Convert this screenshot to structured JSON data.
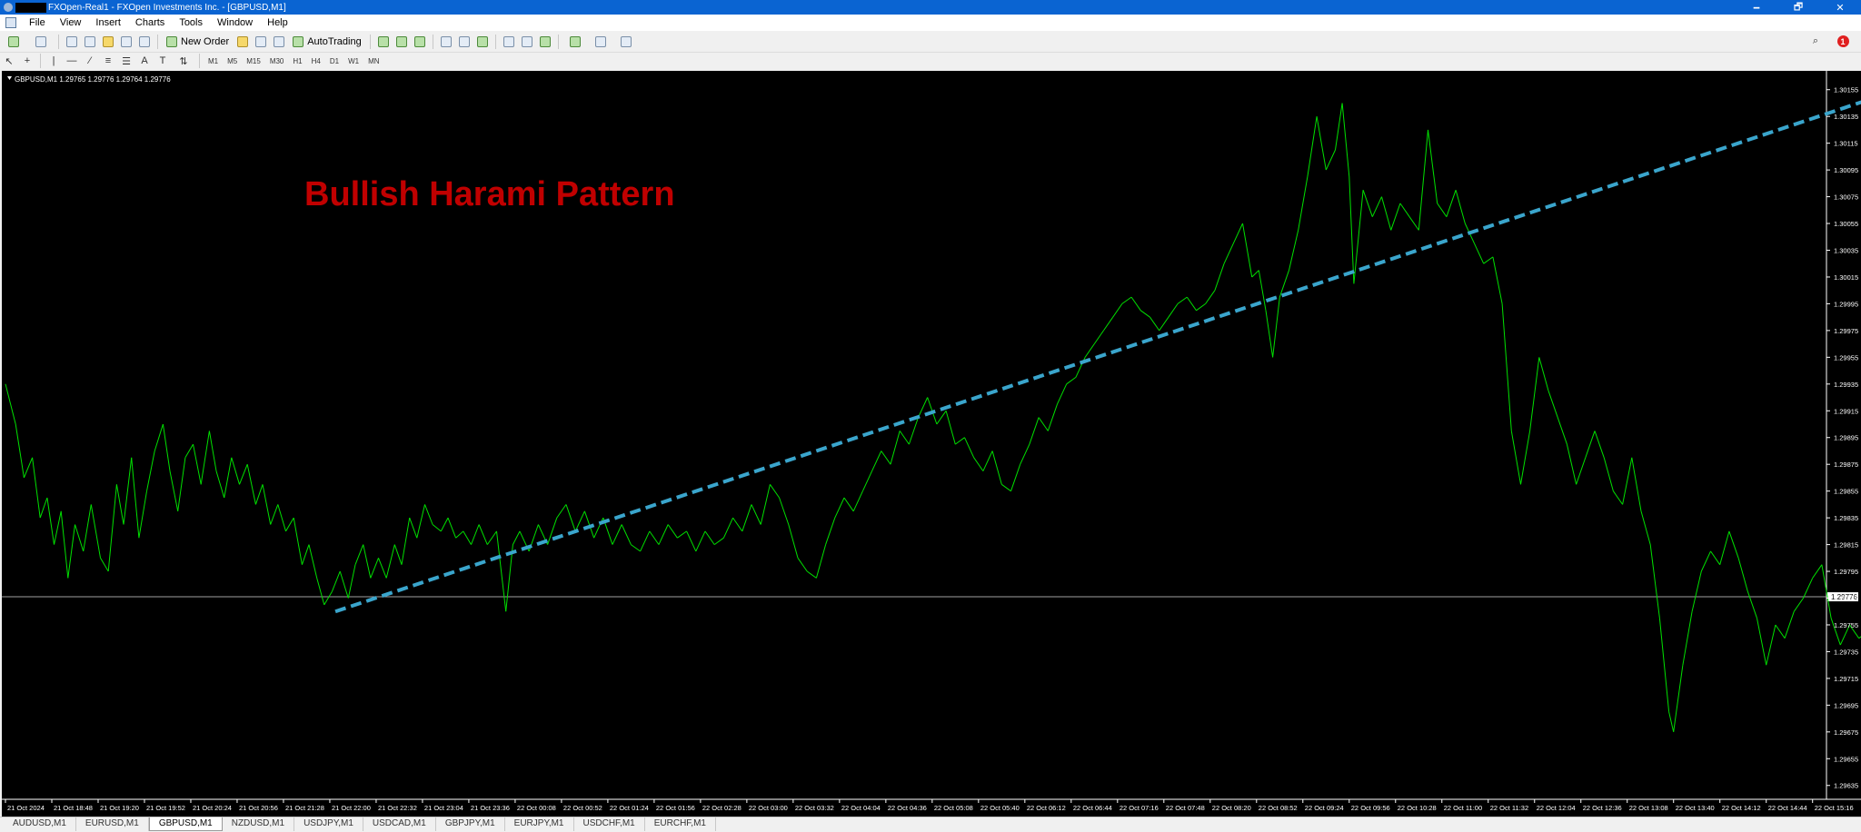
{
  "window": {
    "title": "FXOpen-Real1 - FXOpen Investments Inc. - [GBPUSD,M1]",
    "controls": [
      "🗕",
      "🗗",
      "✕"
    ]
  },
  "menu": [
    "File",
    "View",
    "Insert",
    "Charts",
    "Tools",
    "Window",
    "Help"
  ],
  "toolbar": {
    "new_order": "New Order",
    "autotrading": "AutoTrading",
    "timeframes": [
      "M1",
      "M5",
      "M15",
      "M30",
      "H1",
      "H4",
      "D1",
      "W1",
      "MN"
    ],
    "notification_count": "1"
  },
  "chart": {
    "info": "GBPUSD,M1  1.29765 1.29776 1.29764 1.29776",
    "annotation": "Bullish Harami Pattern",
    "annotation_color": "#c00000",
    "line_color": "#00e000",
    "trend_color": "#3aa5cc",
    "bid_label": "1.29776",
    "bid_price": 1.29776
  },
  "chart_data": {
    "type": "line",
    "symbol": "GBPUSD",
    "timeframe": "M1",
    "x_ticks": [
      "21 Oct 2024",
      "21 Oct 18:48",
      "21 Oct 19:20",
      "21 Oct 19:52",
      "21 Oct 20:24",
      "21 Oct 20:56",
      "21 Oct 21:28",
      "21 Oct 22:00",
      "21 Oct 22:32",
      "21 Oct 23:04",
      "21 Oct 23:36",
      "22 Oct 00:08",
      "22 Oct 00:52",
      "22 Oct 01:24",
      "22 Oct 01:56",
      "22 Oct 02:28",
      "22 Oct 03:00",
      "22 Oct 03:32",
      "22 Oct 04:04",
      "22 Oct 04:36",
      "22 Oct 05:08",
      "22 Oct 05:40",
      "22 Oct 06:12",
      "22 Oct 06:44",
      "22 Oct 07:16",
      "22 Oct 07:48",
      "22 Oct 08:20",
      "22 Oct 08:52",
      "22 Oct 09:24",
      "22 Oct 09:56",
      "22 Oct 10:28",
      "22 Oct 11:00",
      "22 Oct 11:32",
      "22 Oct 12:04",
      "22 Oct 12:36",
      "22 Oct 13:08",
      "22 Oct 13:40",
      "22 Oct 14:12",
      "22 Oct 14:44",
      "22 Oct 15:16"
    ],
    "y_ticks": [
      "1.30155",
      "1.30135",
      "1.30115",
      "1.30095",
      "1.30075",
      "1.30055",
      "1.30035",
      "1.30015",
      "1.29995",
      "1.29975",
      "1.29955",
      "1.29935",
      "1.29915",
      "1.29895",
      "1.29875",
      "1.29855",
      "1.29835",
      "1.29815",
      "1.29795",
      "1.29775",
      "1.29755",
      "1.29735",
      "1.29715",
      "1.29695",
      "1.29675",
      "1.29655",
      "1.29635"
    ],
    "ylim": [
      1.29626,
      1.30165
    ],
    "xlim": [
      0,
      39
    ],
    "series": [
      {
        "points": [
          [
            0.0,
            1.29935
          ],
          [
            0.22,
            1.29905
          ],
          [
            0.4,
            1.29865
          ],
          [
            0.58,
            1.2988
          ],
          [
            0.75,
            1.29835
          ],
          [
            0.9,
            1.2985
          ],
          [
            1.05,
            1.29815
          ],
          [
            1.2,
            1.2984
          ],
          [
            1.35,
            1.2979
          ],
          [
            1.5,
            1.2983
          ],
          [
            1.68,
            1.2981
          ],
          [
            1.85,
            1.29845
          ],
          [
            2.05,
            1.29805
          ],
          [
            2.22,
            1.29795
          ],
          [
            2.4,
            1.2986
          ],
          [
            2.55,
            1.2983
          ],
          [
            2.72,
            1.2988
          ],
          [
            2.88,
            1.2982
          ],
          [
            3.05,
            1.29855
          ],
          [
            3.22,
            1.29885
          ],
          [
            3.4,
            1.29905
          ],
          [
            3.55,
            1.2987
          ],
          [
            3.72,
            1.2984
          ],
          [
            3.88,
            1.2988
          ],
          [
            4.05,
            1.2989
          ],
          [
            4.22,
            1.2986
          ],
          [
            4.4,
            1.299
          ],
          [
            4.55,
            1.2987
          ],
          [
            4.72,
            1.2985
          ],
          [
            4.88,
            1.2988
          ],
          [
            5.05,
            1.2986
          ],
          [
            5.22,
            1.29875
          ],
          [
            5.4,
            1.29845
          ],
          [
            5.55,
            1.2986
          ],
          [
            5.72,
            1.2983
          ],
          [
            5.88,
            1.29845
          ],
          [
            6.05,
            1.29825
          ],
          [
            6.22,
            1.29835
          ],
          [
            6.4,
            1.298
          ],
          [
            6.55,
            1.29815
          ],
          [
            6.72,
            1.2979
          ],
          [
            6.88,
            1.2977
          ],
          [
            7.05,
            1.2978
          ],
          [
            7.22,
            1.29795
          ],
          [
            7.4,
            1.29775
          ],
          [
            7.55,
            1.298
          ],
          [
            7.72,
            1.29815
          ],
          [
            7.88,
            1.2979
          ],
          [
            8.05,
            1.29805
          ],
          [
            8.22,
            1.2979
          ],
          [
            8.4,
            1.29815
          ],
          [
            8.55,
            1.298
          ],
          [
            8.72,
            1.29835
          ],
          [
            8.88,
            1.2982
          ],
          [
            9.05,
            1.29845
          ],
          [
            9.22,
            1.2983
          ],
          [
            9.4,
            1.29825
          ],
          [
            9.55,
            1.29835
          ],
          [
            9.72,
            1.2982
          ],
          [
            9.88,
            1.29825
          ],
          [
            10.05,
            1.29815
          ],
          [
            10.22,
            1.2983
          ],
          [
            10.4,
            1.29815
          ],
          [
            10.6,
            1.29825
          ],
          [
            10.8,
            1.29765
          ],
          [
            10.95,
            1.29815
          ],
          [
            11.1,
            1.29825
          ],
          [
            11.3,
            1.2981
          ],
          [
            11.5,
            1.2983
          ],
          [
            11.7,
            1.29815
          ],
          [
            11.9,
            1.29835
          ],
          [
            12.1,
            1.29845
          ],
          [
            12.3,
            1.29825
          ],
          [
            12.5,
            1.2984
          ],
          [
            12.7,
            1.2982
          ],
          [
            12.9,
            1.29835
          ],
          [
            13.1,
            1.29815
          ],
          [
            13.3,
            1.2983
          ],
          [
            13.5,
            1.29815
          ],
          [
            13.7,
            1.2981
          ],
          [
            13.9,
            1.29825
          ],
          [
            14.1,
            1.29815
          ],
          [
            14.3,
            1.2983
          ],
          [
            14.5,
            1.2982
          ],
          [
            14.7,
            1.29825
          ],
          [
            14.9,
            1.2981
          ],
          [
            15.1,
            1.29825
          ],
          [
            15.3,
            1.29815
          ],
          [
            15.5,
            1.2982
          ],
          [
            15.7,
            1.29835
          ],
          [
            15.9,
            1.29825
          ],
          [
            16.1,
            1.29845
          ],
          [
            16.3,
            1.2983
          ],
          [
            16.5,
            1.2986
          ],
          [
            16.7,
            1.2985
          ],
          [
            16.9,
            1.2983
          ],
          [
            17.1,
            1.29805
          ],
          [
            17.3,
            1.29795
          ],
          [
            17.5,
            1.2979
          ],
          [
            17.7,
            1.29815
          ],
          [
            17.9,
            1.29835
          ],
          [
            18.1,
            1.2985
          ],
          [
            18.3,
            1.2984
          ],
          [
            18.5,
            1.29855
          ],
          [
            18.7,
            1.2987
          ],
          [
            18.9,
            1.29885
          ],
          [
            19.1,
            1.29875
          ],
          [
            19.3,
            1.299
          ],
          [
            19.5,
            1.2989
          ],
          [
            19.7,
            1.2991
          ],
          [
            19.9,
            1.29925
          ],
          [
            20.1,
            1.29905
          ],
          [
            20.3,
            1.29915
          ],
          [
            20.5,
            1.2989
          ],
          [
            20.7,
            1.29895
          ],
          [
            20.9,
            1.2988
          ],
          [
            21.1,
            1.2987
          ],
          [
            21.3,
            1.29885
          ],
          [
            21.5,
            1.2986
          ],
          [
            21.7,
            1.29855
          ],
          [
            21.9,
            1.29875
          ],
          [
            22.1,
            1.2989
          ],
          [
            22.3,
            1.2991
          ],
          [
            22.5,
            1.299
          ],
          [
            22.7,
            1.2992
          ],
          [
            22.9,
            1.29935
          ],
          [
            23.1,
            1.2994
          ],
          [
            23.3,
            1.29955
          ],
          [
            23.5,
            1.29965
          ],
          [
            23.7,
            1.29975
          ],
          [
            23.9,
            1.29985
          ],
          [
            24.1,
            1.29995
          ],
          [
            24.3,
            1.3
          ],
          [
            24.5,
            1.2999
          ],
          [
            24.7,
            1.29985
          ],
          [
            24.9,
            1.29975
          ],
          [
            25.1,
            1.29985
          ],
          [
            25.3,
            1.29995
          ],
          [
            25.5,
            1.3
          ],
          [
            25.7,
            1.2999
          ],
          [
            25.9,
            1.29995
          ],
          [
            26.1,
            1.30005
          ],
          [
            26.3,
            1.30025
          ],
          [
            26.5,
            1.3004
          ],
          [
            26.7,
            1.30055
          ],
          [
            26.9,
            1.30015
          ],
          [
            27.05,
            1.3002
          ],
          [
            27.2,
            1.2999
          ],
          [
            27.35,
            1.29955
          ],
          [
            27.5,
            1.3
          ],
          [
            27.7,
            1.3002
          ],
          [
            27.9,
            1.3005
          ],
          [
            28.1,
            1.3009
          ],
          [
            28.3,
            1.30135
          ],
          [
            28.5,
            1.30095
          ],
          [
            28.7,
            1.3011
          ],
          [
            28.85,
            1.30145
          ],
          [
            29.0,
            1.3009
          ],
          [
            29.1,
            1.3001
          ],
          [
            29.3,
            1.3008
          ],
          [
            29.5,
            1.3006
          ],
          [
            29.7,
            1.30075
          ],
          [
            29.9,
            1.3005
          ],
          [
            30.1,
            1.3007
          ],
          [
            30.3,
            1.3006
          ],
          [
            30.5,
            1.3005
          ],
          [
            30.7,
            1.30125
          ],
          [
            30.9,
            1.3007
          ],
          [
            31.1,
            1.3006
          ],
          [
            31.3,
            1.3008
          ],
          [
            31.5,
            1.30055
          ],
          [
            31.7,
            1.3004
          ],
          [
            31.9,
            1.30025
          ],
          [
            32.1,
            1.3003
          ],
          [
            32.3,
            1.29995
          ],
          [
            32.5,
            1.299
          ],
          [
            32.7,
            1.2986
          ],
          [
            32.9,
            1.299
          ],
          [
            33.1,
            1.29955
          ],
          [
            33.3,
            1.2993
          ],
          [
            33.5,
            1.2991
          ],
          [
            33.7,
            1.2989
          ],
          [
            33.9,
            1.2986
          ],
          [
            34.1,
            1.2988
          ],
          [
            34.3,
            1.299
          ],
          [
            34.5,
            1.2988
          ],
          [
            34.7,
            1.29855
          ],
          [
            34.9,
            1.29845
          ],
          [
            35.1,
            1.2988
          ],
          [
            35.3,
            1.2984
          ],
          [
            35.5,
            1.29815
          ],
          [
            35.7,
            1.2976
          ],
          [
            35.9,
            1.2969
          ],
          [
            36.0,
            1.29675
          ],
          [
            36.2,
            1.29725
          ],
          [
            36.4,
            1.29765
          ],
          [
            36.6,
            1.29795
          ],
          [
            36.8,
            1.2981
          ],
          [
            37.0,
            1.298
          ],
          [
            37.2,
            1.29825
          ],
          [
            37.4,
            1.29805
          ],
          [
            37.6,
            1.2978
          ],
          [
            37.8,
            1.2976
          ],
          [
            38.0,
            1.29725
          ],
          [
            38.2,
            1.29755
          ],
          [
            38.4,
            1.29745
          ],
          [
            38.6,
            1.29765
          ],
          [
            38.8,
            1.29775
          ],
          [
            39.0,
            1.2979
          ],
          [
            39.2,
            1.298
          ],
          [
            39.4,
            1.2976
          ],
          [
            39.6,
            1.2974
          ],
          [
            39.8,
            1.29755
          ],
          [
            40.0,
            1.29745
          ],
          [
            40.2,
            1.2975
          ],
          [
            40.4,
            1.2979
          ],
          [
            40.6,
            1.2977
          ],
          [
            40.8,
            1.29835
          ],
          [
            41.0,
            1.29805
          ],
          [
            41.15,
            1.29776
          ]
        ]
      }
    ],
    "trend_line": {
      "from": [
        7.12,
        1.29765
      ],
      "to": [
        40.8,
        1.30155
      ]
    },
    "grid": false,
    "bid_line": 1.29776
  },
  "tabs": [
    "AUDUSD,M1",
    "EURUSD,M1",
    "GBPUSD,M1",
    "NZDUSD,M1",
    "USDJPY,M1",
    "USDCAD,M1",
    "GBPJPY,M1",
    "EURJPY,M1",
    "USDCHF,M1",
    "EURCHF,M1"
  ],
  "active_tab": "GBPUSD,M1"
}
